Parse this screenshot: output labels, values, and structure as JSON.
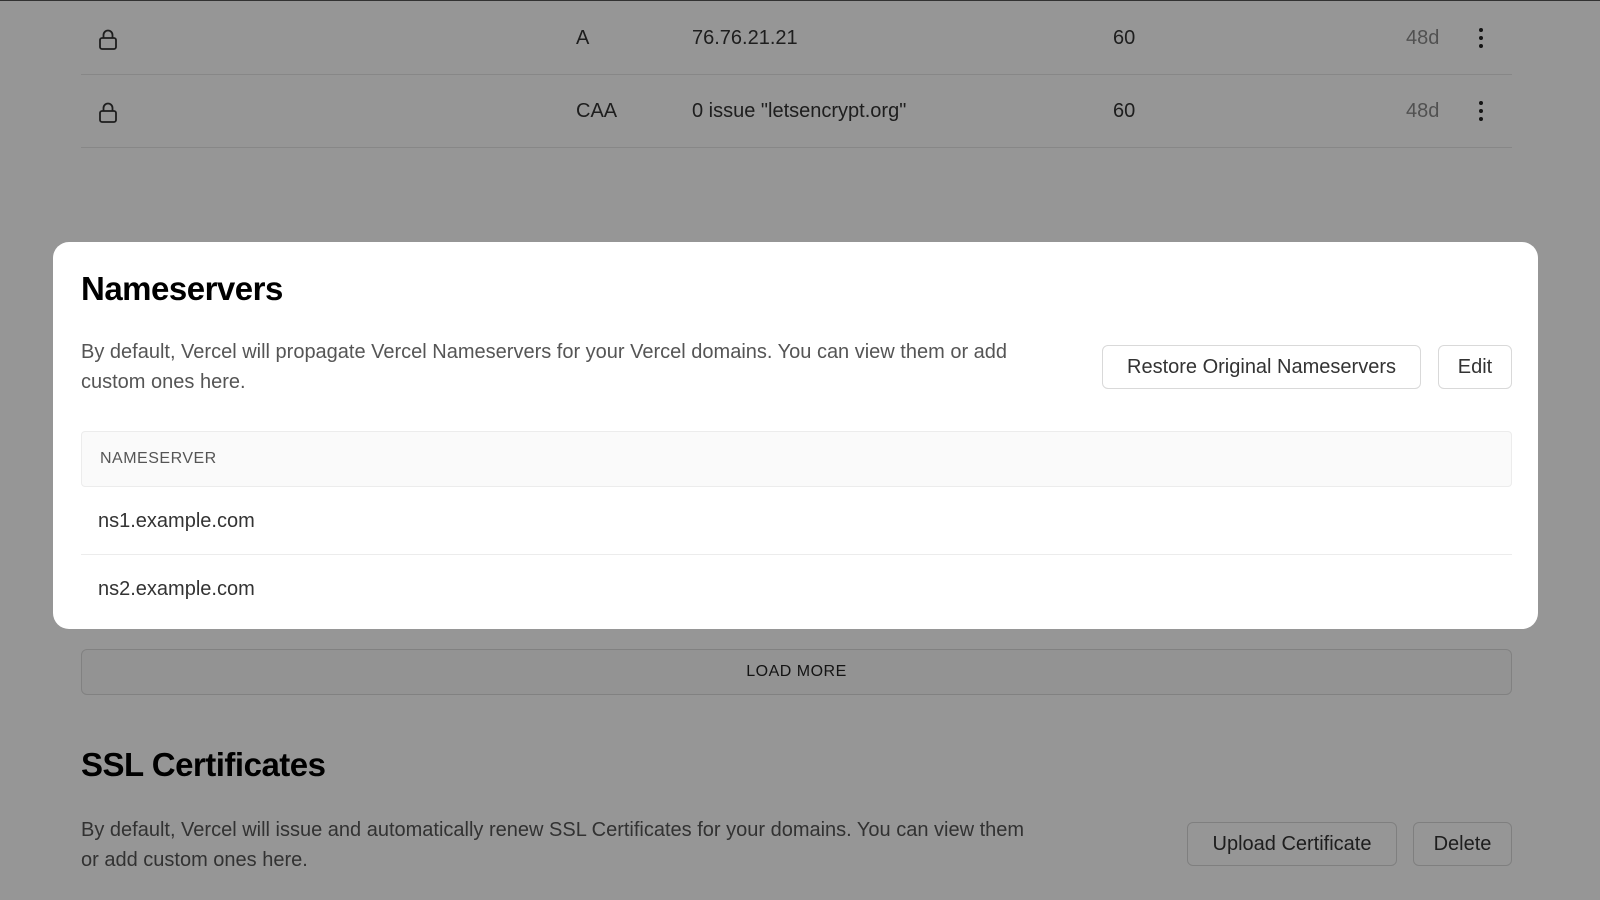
{
  "dns_records": [
    {
      "type": "A",
      "value": "76.76.21.21",
      "ttl": "60",
      "age": "48d"
    },
    {
      "type": "CAA",
      "value": "0 issue \"letsencrypt.org\"",
      "ttl": "60",
      "age": "48d"
    }
  ],
  "load_more_label": "LOAD MORE",
  "ssl": {
    "title": "SSL Certificates",
    "description": "By default, Vercel will issue and automatically renew SSL Certificates for your domains. You can view them or add custom ones here.",
    "upload_label": "Upload Certificate",
    "delete_label": "Delete"
  },
  "modal": {
    "title": "Nameservers",
    "description": "By default, Vercel will propagate Vercel Nameservers for your Vercel domains. You can view them or add custom ones here.",
    "restore_label": "Restore Original Nameservers",
    "edit_label": "Edit",
    "table_header": "NAMESERVER",
    "nameservers": [
      "ns1.example.com",
      "ns2.example.com"
    ]
  },
  "icons": {
    "lock": "lock-icon",
    "more": "more-vertical-icon"
  },
  "colors": {
    "overlay": "#000000",
    "modal_bg": "#ffffff",
    "text_muted": "#555555"
  }
}
